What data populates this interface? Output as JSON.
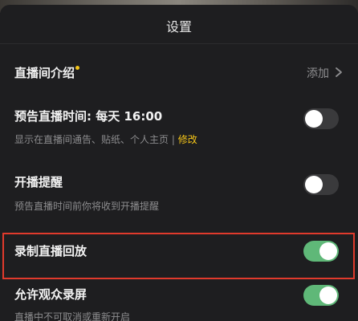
{
  "sheet": {
    "title": "设置"
  },
  "rows": {
    "intro": {
      "title": "直播间介绍",
      "action": "添加"
    },
    "preview_time": {
      "title": "预告直播时间: 每天 16:00",
      "subtitle": "显示在直播间通告、贴纸、个人主页 | ",
      "link": "修改",
      "toggle": false
    },
    "start_reminder": {
      "title": "开播提醒",
      "subtitle": "预告直播时间前你将收到开播提醒",
      "toggle": false
    },
    "record_replay": {
      "title": "录制直播回放",
      "toggle": true
    },
    "allow_record": {
      "title": "允许观众录屏",
      "subtitle": "直播中不可取消或重新开启",
      "toggle": true
    }
  },
  "colors": {
    "accent": "#f5c518",
    "toggle_on": "#5fb878",
    "highlight": "#e03a2c"
  },
  "icons": {
    "intro_dot": "new-dot-icon",
    "intro_arrow": "chevron-right-icon"
  }
}
